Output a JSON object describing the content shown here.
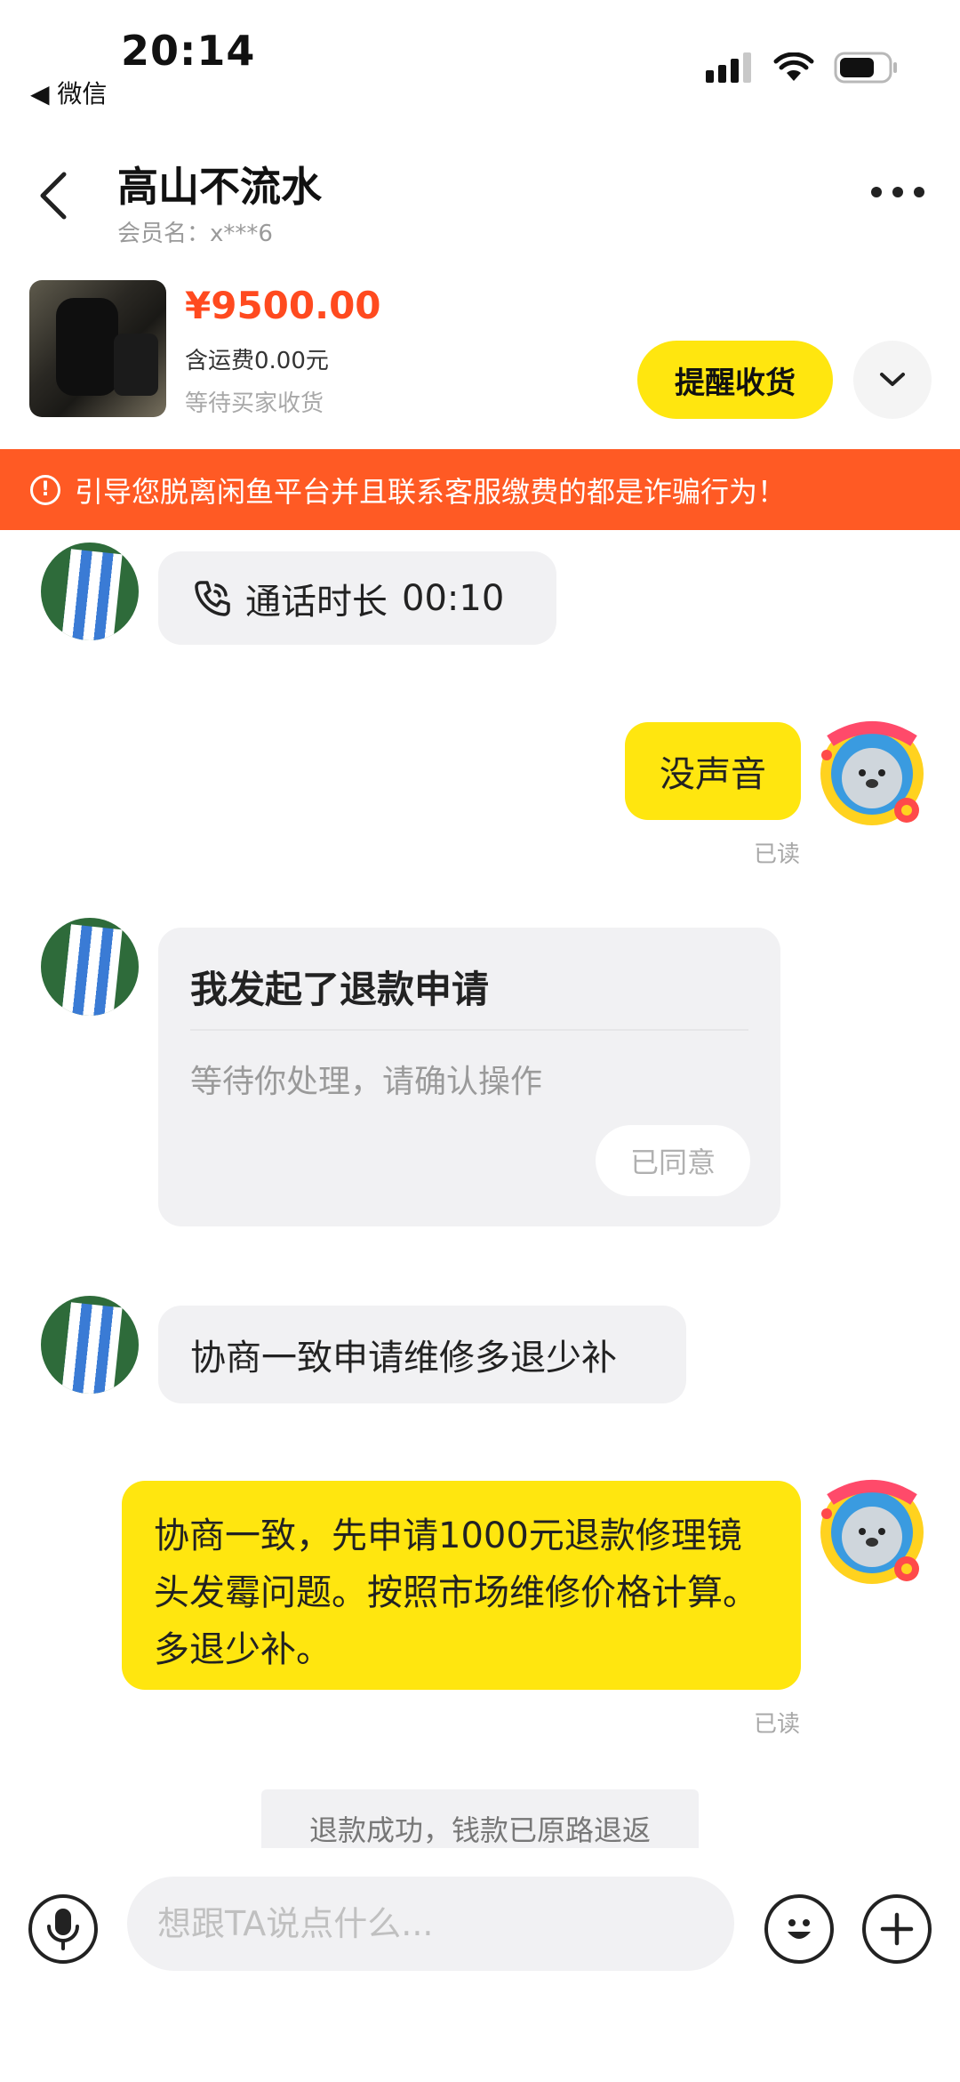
{
  "status_bar": {
    "time": "20:14",
    "back_app": "◀ 微信"
  },
  "header": {
    "title": "高山不流水",
    "member_label": "会员名：",
    "member_id": "x***6"
  },
  "order": {
    "price": "¥9500.00",
    "shipping": "含运费0.00元",
    "status": "等待买家收货",
    "remind_label": "提醒收货"
  },
  "warning": {
    "text": "引导您脱离闲鱼平台并且联系客服缴费的都是诈骗行为！"
  },
  "messages": {
    "call": {
      "label": "通话时长",
      "duration": "00:10"
    },
    "no_sound": "没声音",
    "read_status_1": "已读",
    "refund": {
      "title": "我发起了退款申请",
      "desc": "等待你处理，请确认操作",
      "action": "已同意"
    },
    "negotiate": "协商一致申请维修多退少补",
    "long_reply": "协商一致，先申请1000元退款修理镜头发霉问题。按照市场维修价格计算。多退少补。",
    "read_status_2": "已读",
    "system_note": "退款成功，钱款已原路退返"
  },
  "input": {
    "placeholder": "想跟TA说点什么..."
  },
  "colors": {
    "accent_yellow": "#ffe60f",
    "warning_orange": "#ff5a24",
    "price_red": "#ff4a1f"
  }
}
